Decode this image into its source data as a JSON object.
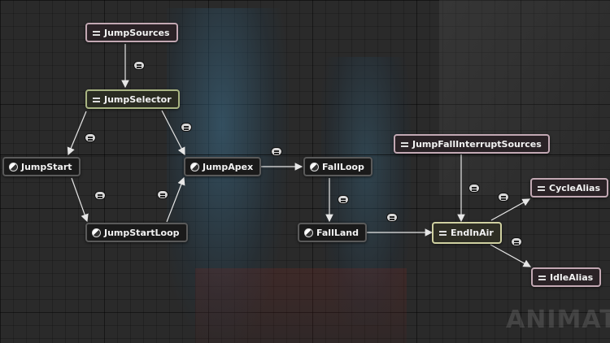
{
  "graph": {
    "nodes": {
      "jump_sources": "JumpSources",
      "jump_selector": "JumpSelector",
      "jump_start": "JumpStart",
      "jump_apex": "JumpApex",
      "fall_loop": "FallLoop",
      "jump_fall_interrupt_sources": "JumpFallInterruptSources",
      "cycle_alias": "CycleAlias",
      "jump_start_loop": "JumpStartLoop",
      "fall_land": "FallLand",
      "end_in_air": "EndInAir",
      "idle_alias": "IdleAlias"
    },
    "edges": [
      [
        "JumpSources",
        "JumpSelector"
      ],
      [
        "JumpSelector",
        "JumpStart"
      ],
      [
        "JumpSelector",
        "JumpApex"
      ],
      [
        "JumpStart",
        "JumpStartLoop"
      ],
      [
        "JumpStartLoop",
        "JumpApex"
      ],
      [
        "JumpApex",
        "FallLoop"
      ],
      [
        "FallLoop",
        "FallLand"
      ],
      [
        "FallLand",
        "EndInAir"
      ],
      [
        "JumpFallInterruptSources",
        "EndInAir"
      ],
      [
        "EndInAir",
        "CycleAlias"
      ],
      [
        "EndInAir",
        "IdleAlias"
      ]
    ]
  },
  "watermark": "ANIMATI",
  "colors": {
    "alias_border": "#c2a8b3",
    "selector_border": "#a9b582",
    "endinair_border": "#cfd0a0",
    "wire": "#e6e6e6"
  }
}
